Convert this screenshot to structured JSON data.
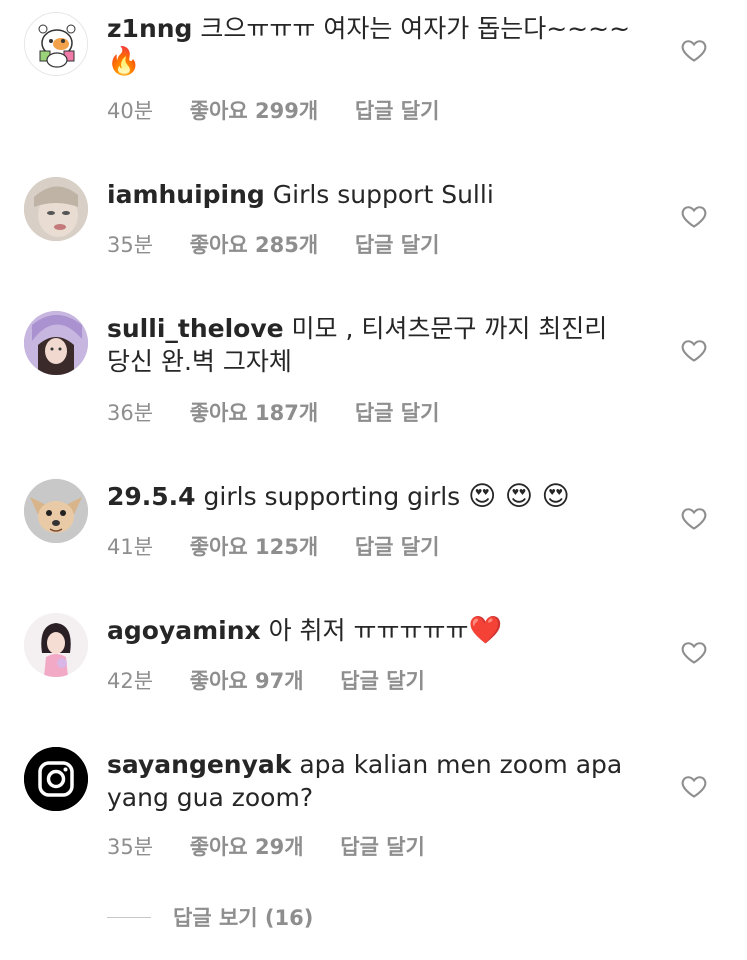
{
  "comments": [
    {
      "username": "z1nng",
      "text": "크으ㅠㅠㅠ 여자는 여자가 돕는다~~~~ ",
      "emoji": "🔥",
      "time": "40분",
      "likes": "좋아요 299개",
      "reply": "답글 달기",
      "avatar_icon": "cartoon-hamster-avatar"
    },
    {
      "username": "iamhuiping",
      "text": "Girls support Sulli",
      "emoji": "",
      "time": "35분",
      "likes": "좋아요 285개",
      "reply": "답글 달기",
      "avatar_icon": "photo-avatar"
    },
    {
      "username": "sulli_thelove",
      "text": "미모 , 티셔츠문구 까지 최진리 당신 완.벽 그자체",
      "emoji": "",
      "time": "36분",
      "likes": "좋아요 187개",
      "reply": "답글 달기",
      "avatar_icon": "photo-avatar"
    },
    {
      "username": "29.5.4",
      "text": "girls supporting girls ",
      "emoji": "😍 😍 😍",
      "time": "41분",
      "likes": "좋아요 125개",
      "reply": "답글 달기",
      "avatar_icon": "dog-photo-avatar"
    },
    {
      "username": "agoyaminx",
      "text": "아 취저 ㅠㅠㅠㅠㅠ",
      "emoji": "❤️",
      "time": "42분",
      "likes": "좋아요 97개",
      "reply": "답글 달기",
      "avatar_icon": "photo-avatar"
    },
    {
      "username": "sayangenyak",
      "text": "apa kalian men zoom apa yang gua zoom?",
      "emoji": "",
      "time": "35분",
      "likes": "좋아요 29개",
      "reply": "답글 달기",
      "avatar_icon": "instagram-logo-avatar"
    }
  ],
  "view_replies": "답글 보기 (16)",
  "colors": {
    "text": "#262626",
    "meta": "#8e8e8e",
    "heart_outline": "#8e8e8e"
  }
}
